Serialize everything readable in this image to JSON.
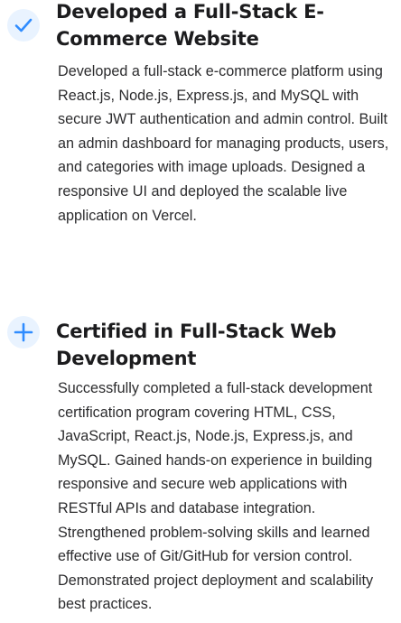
{
  "timeline": {
    "items": [
      {
        "icon": "check-icon",
        "title": "Developed a Full-Stack E-Commerce Website",
        "description": "Developed a full-stack e-commerce platform using React.js, Node.js, Express.js, and MySQL with secure JWT authentication and admin control. Built an admin dashboard for managing products, users, and categories with image uploads. Designed a responsive UI and deployed the scalable live application on Vercel."
      },
      {
        "icon": "plus-icon",
        "title": "Certified in Full-Stack Web Development",
        "description": "Successfully completed a full-stack development certification program covering HTML, CSS, JavaScript, React.js, Node.js, Express.js, and MySQL. Gained hands-on experience in building responsive and secure web applications with RESTful APIs and database integration. Strengthened problem-solving skills and learned effective use of Git/GitHub for version control. Demonstrated project deployment and scalability best practices."
      }
    ],
    "accent_color": "#2f8cff",
    "badge_color": "#e9f3ff"
  }
}
